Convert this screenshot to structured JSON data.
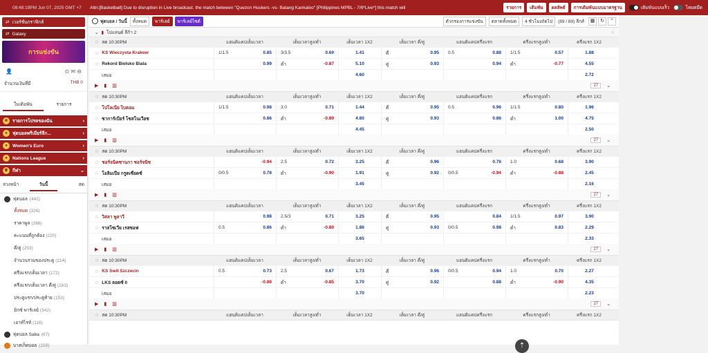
{
  "topbar": {
    "clock": "08:48:19PM Jun 07, 2025 GMT +7",
    "announcement": "Attn:[Basketball] Due to disruption in Live broadcast. the match between \"Quezon Huskers -vs- Batang Kankaloo\" [Philippines MPBL - 7/6*Live*] this match will",
    "buttons": [
      "รายการ",
      "เดิมพัน",
      "ผลลัพธ์",
      "การเดิมพันแบบมาตรฐาน"
    ],
    "toggle1": "เดิมพันแบบเร็ว",
    "toggle2": "โหมดมืด"
  },
  "sidebar": {
    "btn1": "เวอร์ชั่นกราฟิกส์",
    "btn2": "Galaxy",
    "banner": "การแข่งขัน",
    "balance_label": "จำนวนเงินที่มี",
    "balance_value": "THB 0",
    "tabs": [
      "ใบเดิมพัน",
      "รายการ"
    ],
    "menus": [
      "รายการโปรดของฉัน",
      "ฟุตบอลพรีเมียร์ลีก...",
      "Women's Euro",
      "Nations League",
      "กีฬา"
    ],
    "subtabs": [
      "ล่วงหน้า",
      "วันนี้",
      "สด"
    ],
    "sport1": {
      "name": "ฟุตบอล",
      "count": "(442)"
    },
    "subs": [
      {
        "name": "ทั้งหมด",
        "count": "(326)"
      },
      {
        "name": "ราคาพูล",
        "count": "(266)"
      },
      {
        "name": "คะแนนที่ถูกต้อง",
        "count": "(220)"
      },
      {
        "name": "คี่/คู่",
        "count": "(253)"
      },
      {
        "name": "จำนวนรวมของประตู",
        "count": "(214)"
      },
      {
        "name": "ครึ่งแรก/เต็มเวลา",
        "count": "(172)"
      },
      {
        "name": "ครึ่งแรก/เต็มเวลา คี่/คู่",
        "count": "(163)"
      },
      {
        "name": "ประตูแรก/ประตูท้าย",
        "count": "(153)"
      },
      {
        "name": "มิกซ์ พาร์เลย์",
        "count": "(342)"
      },
      {
        "name": "เอาท์ไรท์",
        "count": "(116)"
      }
    ],
    "sport2": {
      "name": "ฟุตบอล Saba",
      "count": "(67)"
    },
    "sport3": {
      "name": "บาสเก็ตบอล",
      "count": "(159)"
    }
  },
  "filter": {
    "title": "ฟุตบอล / วันนี้",
    "select": "ทั้งหมด",
    "parlay": "พาร์เลย์",
    "parlay2": "พาร์เลย์ไซต์",
    "sort": "ตัวกรองการแข่งขัน",
    "market": "ตลาดทั้งหมด",
    "odds": "4 ชั่วโมงถัดไป",
    "count": "(89 / 89) ลีกส์"
  },
  "league": "โปแลนด์ ลีก้า 2",
  "headers": [
    "แฮนดิแคปเต็มเวลา",
    "เต็มเวลาสูง/ต่ำ",
    "เต็มเวลา 1X2",
    "เต็มเวลา คี่/คู่",
    "แฮนดิแคปครึ่งแรก",
    "ครึ่งแรกสูง/ต่ำ",
    "ครึ่งแรก 1X2"
  ],
  "draw_label": "เสมอ",
  "more_label": "27",
  "matches": [
    {
      "time": "สด 10:30PM",
      "home": "KS Wieczysta Krakow",
      "away": "Rekord Bielsko Biala",
      "r1": [
        "1/1.5",
        "0.85",
        "3/3.5",
        "0.69",
        "1.41",
        "คี่",
        "0.95",
        "0.5",
        "0.88",
        "1/1.5",
        "0.57",
        "1.88"
      ],
      "r2": [
        "",
        "0.99",
        "ต่ำ",
        "-0.87",
        "5.10",
        "คู่",
        "0.93",
        "",
        "0.94",
        "ต่ำ",
        "-0.77",
        "4.55"
      ],
      "d": [
        "4.60",
        "2.72"
      ]
    },
    {
      "time": "สด 10:30PM",
      "home": "โปโลเนีย ไบตอม",
      "away": "ซาการ์เบียร์ โซสโนเวียซ",
      "r1": [
        "1/1.5",
        "0.98",
        "3.0",
        "0.71",
        "1.44",
        "คี่",
        "0.95",
        "0.5",
        "0.96",
        "1/1.5",
        "0.80",
        "1.96"
      ],
      "r2": [
        "",
        "0.86",
        "ต่ำ",
        "-0.89",
        "4.80",
        "คู่",
        "0.93",
        "",
        "0.86",
        "ต่ำ",
        "1.00",
        "4.75"
      ],
      "d": [
        "4.45",
        "2.50"
      ]
    },
    {
      "time": "สด 10:30PM",
      "home": "ชอร์จนิคซานกา ชอร์จนิช",
      "away": "โอลิมเปีย กรูดเซียดซ์",
      "r1": [
        "",
        "-0.94",
        "2.5",
        "0.72",
        "3.25",
        "คี่",
        "0.96",
        "",
        "0.76",
        "1.0",
        "0.68",
        "3.90"
      ],
      "r2": [
        "0/0.5",
        "0.78",
        "ต่ำ",
        "-0.90",
        "1.91",
        "คู่",
        "0.92",
        "0/0.5",
        "-0.94",
        "ต่ำ",
        "-0.88",
        "2.45"
      ],
      "d": [
        "3.45",
        "2.16"
      ]
    },
    {
      "time": "สด 10:30PM",
      "home": "วิสลา พูลาวี",
      "away": "ราสโซเวีย เรสซอฟ",
      "r1": [
        "",
        "0.98",
        "2.5/3",
        "0.71",
        "3.25",
        "คี่",
        "0.95",
        "",
        "0.84",
        "1/1.5",
        "0.97",
        "3.90"
      ],
      "r2": [
        "0.5",
        "0.86",
        "ต่ำ",
        "-0.89",
        "1.86",
        "คู่",
        "0.93",
        "0/0.5",
        "0.98",
        "ต่ำ",
        "0.83",
        "2.29"
      ],
      "d": [
        "3.65",
        "2.33"
      ]
    },
    {
      "time": "สด 10:30PM",
      "home": "KS Swit Szczecin",
      "away": "LKS ลอดซ์ II",
      "r1": [
        "0.5",
        "0.73",
        "2.5",
        "0.67",
        "1.73",
        "คี่",
        "0.96",
        "0/0.5",
        "0.94",
        "1.0",
        "0.70",
        "2.27"
      ],
      "r2": [
        "",
        "-0.89",
        "ต่ำ",
        "-0.85",
        "3.70",
        "คู่",
        "0.92",
        "",
        "0.88",
        "ต่ำ",
        "-0.90",
        "4.35"
      ],
      "d": [
        "3.70",
        "2.23"
      ]
    },
    {
      "time": "สด 10:30PM",
      "home": "",
      "away": "",
      "r1": [],
      "r2": [],
      "d": []
    }
  ]
}
